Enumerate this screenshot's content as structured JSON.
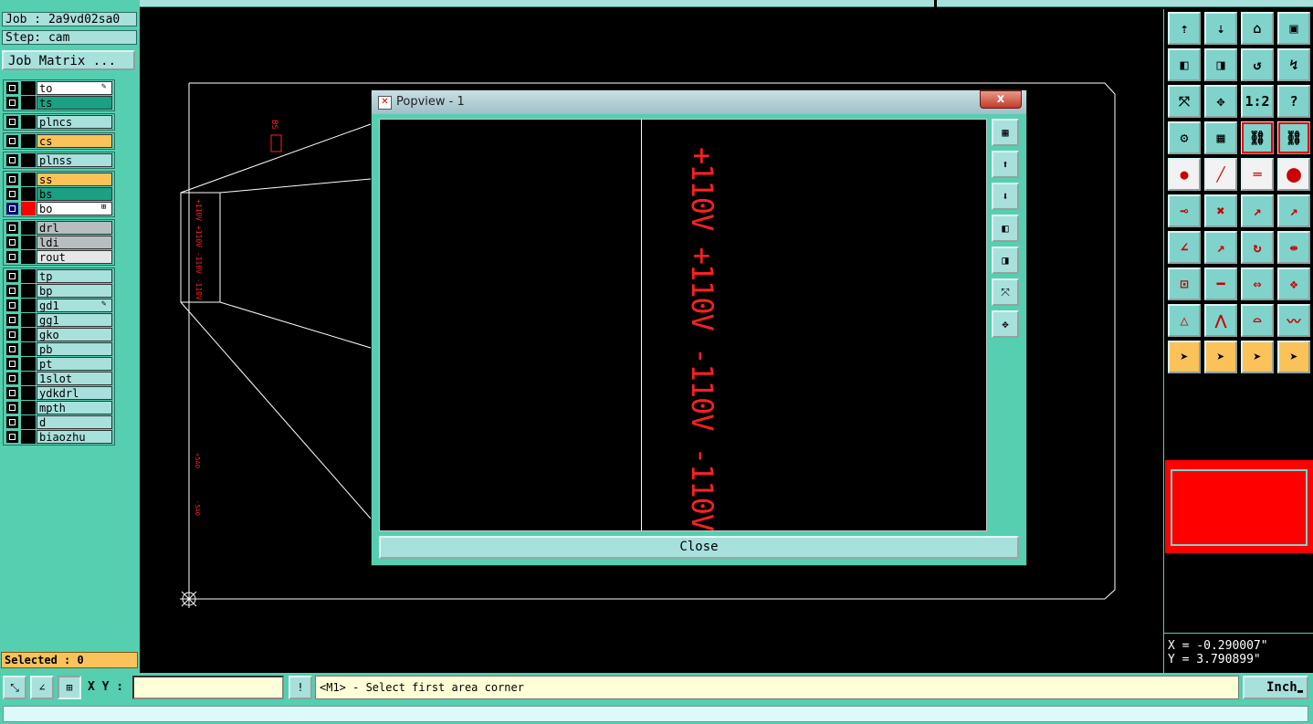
{
  "job": {
    "label": "Job : 2a9vd02sa0",
    "step": "Step: cam",
    "matrix_button": "Job Matrix ..."
  },
  "layers": [
    {
      "name": "to",
      "color": "#ffffff",
      "group": 0,
      "mark": "✎"
    },
    {
      "name": "ts",
      "color": "#1aa082",
      "group": 0,
      "mark": ""
    },
    {
      "name": "plncs",
      "color": "#a8e0dc",
      "group": 1,
      "mark": ""
    },
    {
      "name": "cs",
      "color": "#fbc25a",
      "group": 2,
      "mark": ""
    },
    {
      "name": "plnss",
      "color": "#a8e0dc",
      "group": 3,
      "mark": ""
    },
    {
      "name": "ss",
      "color": "#fbc25a",
      "group": 4,
      "mark": ""
    },
    {
      "name": "bs",
      "color": "#1aa082",
      "group": 4,
      "mark": ""
    },
    {
      "name": "bo",
      "color": "#ffffff",
      "group": 4,
      "mark": "⊞",
      "active": true
    },
    {
      "name": "drl",
      "color": "#b8bec0",
      "group": 5,
      "mark": ""
    },
    {
      "name": "ldi",
      "color": "#b8bec0",
      "group": 5,
      "mark": ""
    },
    {
      "name": "rout",
      "color": "#e6e6e6",
      "group": 5,
      "mark": ""
    },
    {
      "name": "tp",
      "color": "#a8e0dc",
      "group": 6,
      "mark": ""
    },
    {
      "name": "bp",
      "color": "#a8e0dc",
      "group": 6,
      "mark": ""
    },
    {
      "name": "gd1",
      "color": "#a8e0dc",
      "group": 6,
      "mark": "✎"
    },
    {
      "name": "gg1",
      "color": "#a8e0dc",
      "group": 6,
      "mark": ""
    },
    {
      "name": "gko",
      "color": "#a8e0dc",
      "group": 6,
      "mark": ""
    },
    {
      "name": "pb",
      "color": "#a8e0dc",
      "group": 6,
      "mark": ""
    },
    {
      "name": "pt",
      "color": "#a8e0dc",
      "group": 6,
      "mark": ""
    },
    {
      "name": "1slot",
      "color": "#a8e0dc",
      "group": 6,
      "mark": ""
    },
    {
      "name": "ydkdrl",
      "color": "#a8e0dc",
      "group": 6,
      "mark": ""
    },
    {
      "name": "mpth",
      "color": "#a8e0dc",
      "group": 6,
      "mark": ""
    },
    {
      "name": "d",
      "color": "#a8e0dc",
      "group": 6,
      "mark": ""
    },
    {
      "name": "biaozhu",
      "color": "#a8e0dc",
      "group": 6,
      "mark": ""
    }
  ],
  "selected": "Selected : 0",
  "popup": {
    "title": "Popview - 1",
    "close_x": "x",
    "close_button": "Close",
    "text": "+110V +110V -110V -110V"
  },
  "canvas_text": {
    "small_label": "+110V +110V -110V -110V",
    "tag_top": "BS",
    "v1": "+5AO",
    "v2": "-5AO"
  },
  "toolbar": {
    "icons": [
      "zoom-in-icon",
      "zoom-out-icon",
      "home-icon",
      "grid-view-icon",
      "pan-left-icon",
      "pan-right-icon",
      "undo-zoom-icon",
      "redraw-icon",
      "fit-icon",
      "center-icon",
      "scale-icon",
      "help-icon",
      "settings-icon",
      "snap-grid-icon",
      "net-icon",
      "net2-icon",
      "pad-icon",
      "line-icon",
      "ruler-icon",
      "dot-icon",
      "connect-icon",
      "cross-icon",
      "move-icon",
      "copy-icon",
      "angle-icon",
      "measure-icon",
      "rotate-icon",
      "mirror-icon",
      "add-pad-icon",
      "split-icon",
      "stretch-icon",
      "shape-icon",
      "triangle-icon",
      "arc-icon",
      "arch-icon",
      "wave-icon",
      "select-icon",
      "select-box-icon",
      "select-poly-icon",
      "select-net-icon"
    ],
    "labels": [
      "",
      "",
      "",
      "",
      "",
      "",
      "",
      "",
      "",
      "",
      "1:2",
      "?",
      "",
      "",
      "",
      "",
      "",
      "",
      "",
      "",
      "",
      "",
      "",
      "",
      "",
      "",
      "",
      "",
      "",
      "",
      "",
      "",
      "",
      "",
      "",
      "",
      "",
      "",
      "",
      ""
    ]
  },
  "coords": {
    "x": "X = -0.290007\"",
    "y": "Y = 3.790899\""
  },
  "bottom": {
    "xy_label": "X Y :",
    "xy_value": "",
    "prompt": "<M1> - Select first area corner",
    "unit": "Inch",
    "excl": "!"
  }
}
